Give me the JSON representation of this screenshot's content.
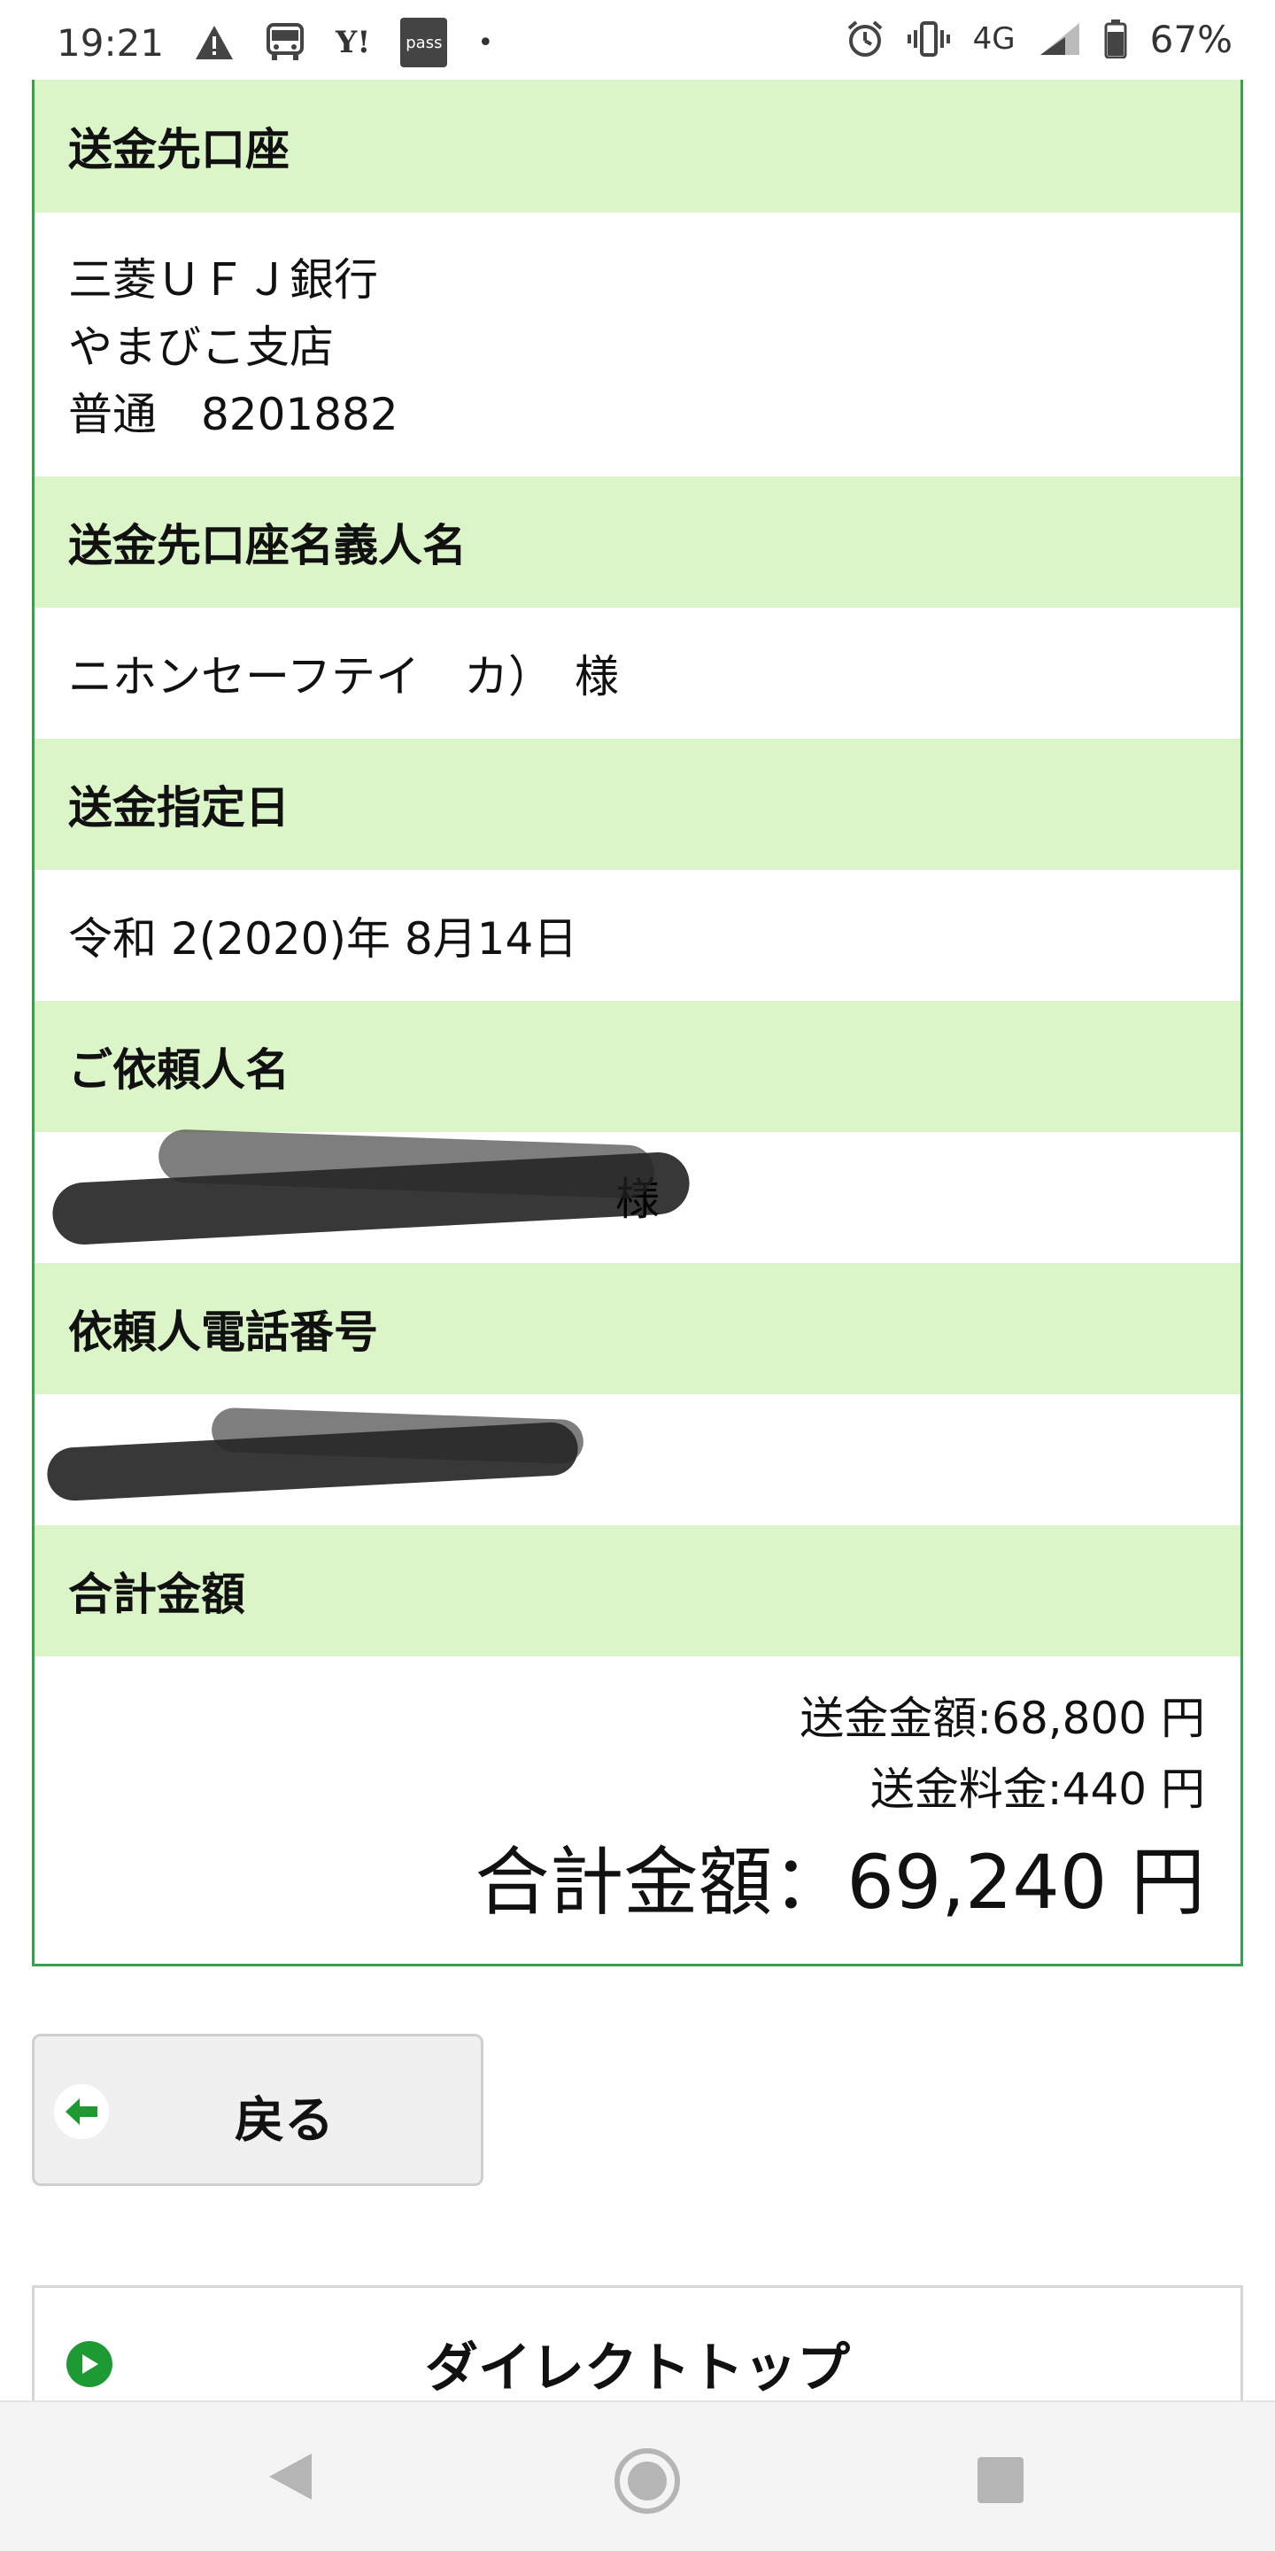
{
  "status_bar": {
    "time": "19:21",
    "yahoo_label": "Y!",
    "pass_label": "pass",
    "dot": "•",
    "network": "4G",
    "battery": "67%"
  },
  "transfer": {
    "dest_account": {
      "header": "送金先口座",
      "bank": "三菱ＵＦＪ銀行",
      "branch": "やまびこ支店",
      "account": "普通　8201882"
    },
    "dest_name": {
      "header": "送金先口座名義人名",
      "value": "ニホンセーフテイ　カ）　様"
    },
    "date": {
      "header": "送金指定日",
      "value": "令和 2(2020)年 8月14日"
    },
    "requester": {
      "header": "ご依頼人名",
      "value_visible": "様"
    },
    "phone": {
      "header": "依頼人電話番号"
    },
    "total": {
      "header": "合計金額",
      "amount_line": "送金金額:68,800 円",
      "fee_line": "送金料金:440 円",
      "total_line": "合計金額：69,240 円"
    }
  },
  "buttons": {
    "back": "戻る",
    "direct_top": "ダイレクトトップ"
  },
  "colors": {
    "header_bg": "#dcf5c8",
    "border_green": "#36a14a",
    "icon_green": "#1e9a33"
  }
}
